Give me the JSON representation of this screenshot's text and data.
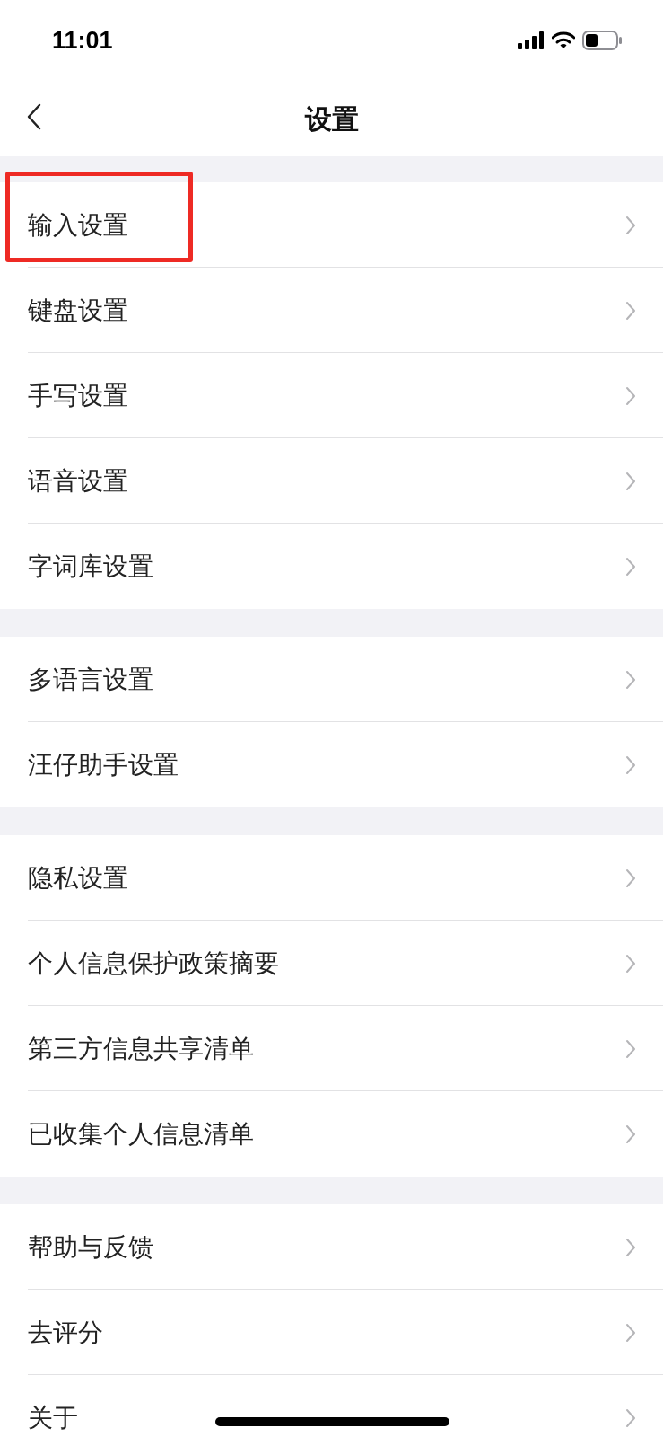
{
  "status_bar": {
    "time": "11:01"
  },
  "nav": {
    "title": "设置"
  },
  "sections": [
    {
      "items": [
        {
          "label": "输入设置",
          "highlighted": true
        },
        {
          "label": "键盘设置",
          "highlighted": false
        },
        {
          "label": "手写设置",
          "highlighted": false
        },
        {
          "label": "语音设置",
          "highlighted": false
        },
        {
          "label": "字词库设置",
          "highlighted": false
        }
      ]
    },
    {
      "items": [
        {
          "label": "多语言设置",
          "highlighted": false
        },
        {
          "label": "汪仔助手设置",
          "highlighted": false
        }
      ]
    },
    {
      "items": [
        {
          "label": "隐私设置",
          "highlighted": false
        },
        {
          "label": "个人信息保护政策摘要",
          "highlighted": false
        },
        {
          "label": "第三方信息共享清单",
          "highlighted": false
        },
        {
          "label": "已收集个人信息清单",
          "highlighted": false
        }
      ]
    },
    {
      "items": [
        {
          "label": "帮助与反馈",
          "highlighted": false
        },
        {
          "label": "去评分",
          "highlighted": false
        },
        {
          "label": "关于",
          "highlighted": false
        }
      ]
    }
  ]
}
